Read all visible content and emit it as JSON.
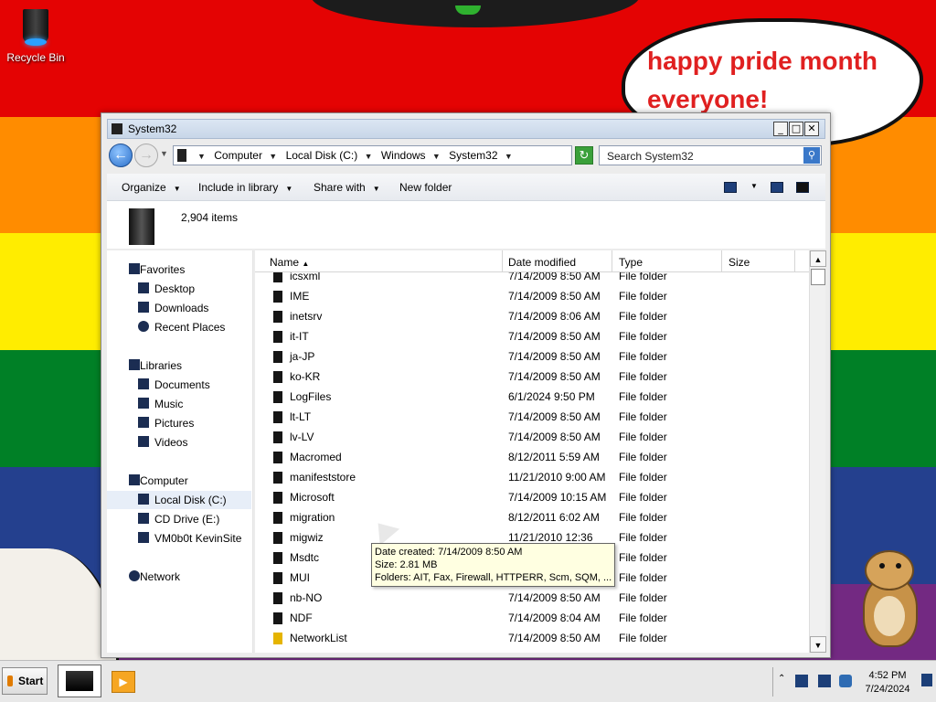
{
  "desktop": {
    "recycle_bin_label": "Recycle Bin",
    "speech_bubble_text": "happy pride month everyone!"
  },
  "window": {
    "title": "System32",
    "title_buttons": {
      "minimize": "_",
      "maximize": "□",
      "close": "✕"
    },
    "address_bar": {
      "crumbs": [
        "Computer",
        "Local Disk (C:)",
        "Windows",
        "System32"
      ]
    },
    "search": {
      "placeholder": "Search System32"
    },
    "toolbar": {
      "organize": "Organize",
      "include_in_library": "Include in library",
      "share_with": "Share with",
      "new_folder": "New folder"
    },
    "item_count": "2,904 items",
    "nav_pane": {
      "favorites": "Favorites",
      "desktop": "Desktop",
      "downloads": "Downloads",
      "recent_places": "Recent Places",
      "libraries": "Libraries",
      "documents": "Documents",
      "music": "Music",
      "pictures": "Pictures",
      "videos": "Videos",
      "computer": "Computer",
      "local_disk": "Local Disk (C:)",
      "cd_drive": "CD Drive (E:)",
      "network_drive": "VM0b0t KevinSite",
      "network": "Network"
    },
    "columns": {
      "name": "Name",
      "date_modified": "Date modified",
      "type": "Type",
      "size": "Size"
    },
    "files": [
      {
        "name": "icsxml",
        "date": "7/14/2009 8:50 AM",
        "type": "File folder"
      },
      {
        "name": "IME",
        "date": "7/14/2009 8:50 AM",
        "type": "File folder"
      },
      {
        "name": "inetsrv",
        "date": "7/14/2009 8:06 AM",
        "type": "File folder"
      },
      {
        "name": "it-IT",
        "date": "7/14/2009 8:50 AM",
        "type": "File folder"
      },
      {
        "name": "ja-JP",
        "date": "7/14/2009 8:50 AM",
        "type": "File folder"
      },
      {
        "name": "ko-KR",
        "date": "7/14/2009 8:50 AM",
        "type": "File folder"
      },
      {
        "name": "LogFiles",
        "date": "6/1/2024 9:50 PM",
        "type": "File folder"
      },
      {
        "name": "lt-LT",
        "date": "7/14/2009 8:50 AM",
        "type": "File folder"
      },
      {
        "name": "lv-LV",
        "date": "7/14/2009 8:50 AM",
        "type": "File folder"
      },
      {
        "name": "Macromed",
        "date": "8/12/2011 5:59 AM",
        "type": "File folder"
      },
      {
        "name": "manifeststore",
        "date": "11/21/2010 9:00 AM",
        "type": "File folder"
      },
      {
        "name": "Microsoft",
        "date": "7/14/2009 10:15 AM",
        "type": "File folder"
      },
      {
        "name": "migration",
        "date": "8/12/2011 6:02 AM",
        "type": "File folder"
      },
      {
        "name": "migwiz",
        "date": "11/21/2010 12:36",
        "type": "File folder"
      },
      {
        "name": "Msdtc",
        "date": "",
        "type": "File folder"
      },
      {
        "name": "MUI",
        "date": "",
        "type": "File folder"
      },
      {
        "name": "nb-NO",
        "date": "7/14/2009 8:50 AM",
        "type": "File folder"
      },
      {
        "name": "NDF",
        "date": "7/14/2009 8:04 AM",
        "type": "File folder"
      },
      {
        "name": "NetworkList",
        "date": "7/14/2009 8:50 AM",
        "type": "File folder"
      }
    ],
    "tooltip": {
      "line1": "Date created: 7/14/2009 8:50 AM",
      "line2": "Size: 2.81 MB",
      "line3": "Folders: AIT, Fax, Firewall, HTTPERR, Scm, SQM, ..."
    }
  },
  "taskbar": {
    "start_label": "Start",
    "clock_time": "4:52 PM",
    "clock_date": "7/24/2024"
  }
}
